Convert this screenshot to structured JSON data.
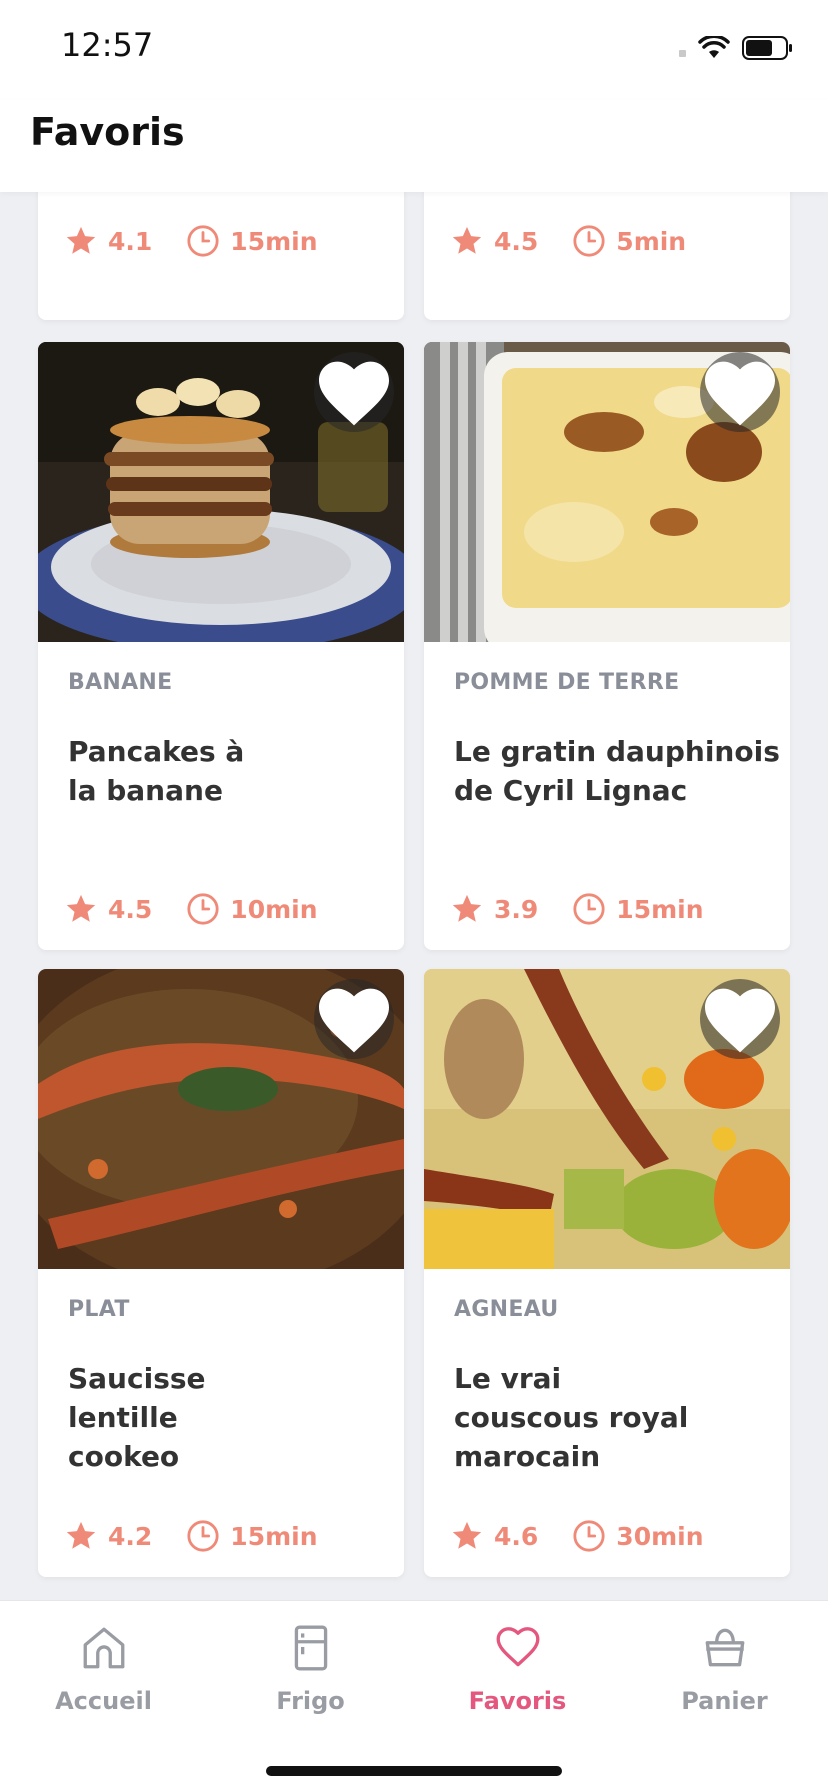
{
  "status_bar": {
    "time": "12:57"
  },
  "header": {
    "title": "Favoris"
  },
  "top_cards": [
    {
      "rating": "4.1",
      "time": "15min"
    },
    {
      "rating": "4.5",
      "time": "5min"
    }
  ],
  "cards": [
    {
      "category": "BANANE",
      "title": "Pancakes à la banane",
      "rating": "4.5",
      "time": "10min",
      "image": "pancakes-photo"
    },
    {
      "category": "POMME DE TERRE",
      "title": "Le gratin dauphinois de Cyril Lignac",
      "rating": "3.9",
      "time": "15min",
      "image": "gratin-photo"
    },
    {
      "category": "PLAT",
      "title": "Saucisse lentille cookeo",
      "rating": "4.2",
      "time": "15min",
      "image": "lentils-sausage-photo"
    },
    {
      "category": "AGNEAU",
      "title": "Le vrai couscous royal marocain",
      "rating": "4.6",
      "time": "30min",
      "image": "couscous-photo"
    }
  ],
  "tabbar": {
    "tabs": [
      {
        "label": "Accueil",
        "icon": "home-icon"
      },
      {
        "label": "Frigo",
        "icon": "fridge-icon"
      },
      {
        "label": "Favoris",
        "icon": "heart-icon",
        "active": true
      },
      {
        "label": "Panier",
        "icon": "basket-icon"
      }
    ]
  },
  "colors": {
    "accent": "#f08a78",
    "active_tab": "#e4577e",
    "category": "#8a8e98"
  }
}
